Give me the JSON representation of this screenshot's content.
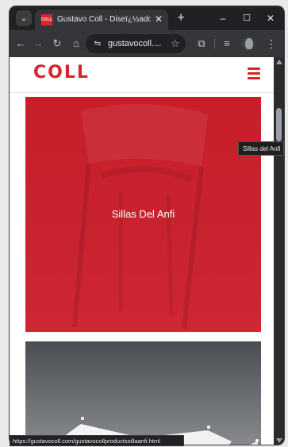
{
  "browser": {
    "tab": {
      "favicon_text": "COLL",
      "title": "Gustavo Coll - Diseï¿½ador de",
      "close": "✕"
    },
    "new_tab": "+",
    "window_controls": {
      "minimize": "–",
      "maximize": "☐",
      "close": "✕"
    },
    "toolbar": {
      "back": "←",
      "forward": "→",
      "reload": "↻",
      "home": "⌂",
      "site_info": "⇋",
      "url": "gustavocoll....",
      "bookmark": "☆",
      "extensions": "⧉",
      "media": "≡",
      "more": "⋮"
    }
  },
  "site": {
    "logo": "COLL",
    "accent_color": "#d6232c",
    "cards": [
      {
        "label": "Sillas Del Anfi",
        "color": "#c8222e"
      }
    ]
  },
  "tooltip": "Sillas del Anfi",
  "status_url": "https://gustavocoll.com/gustavocollproductssillaanfi.html"
}
